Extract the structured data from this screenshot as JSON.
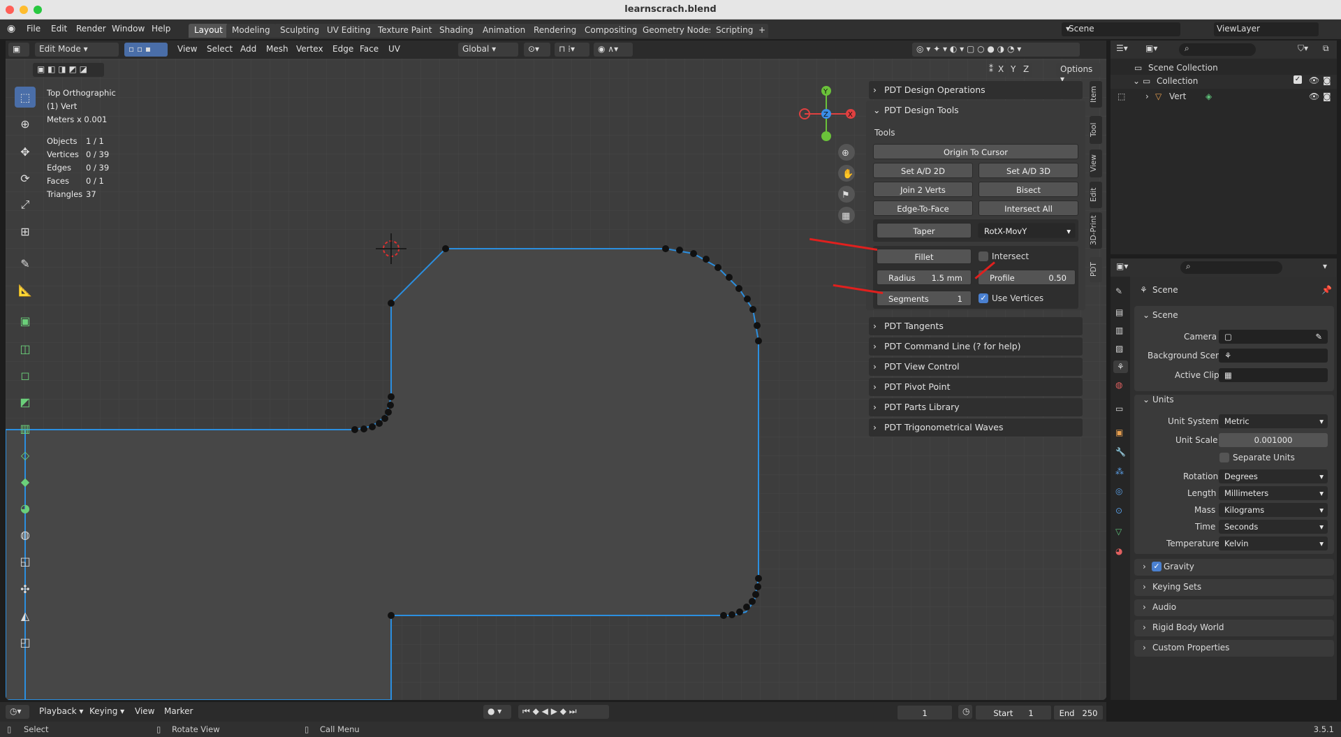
{
  "window": {
    "title": "learnscrach.blend"
  },
  "menu": [
    "File",
    "Edit",
    "Render",
    "Window",
    "Help"
  ],
  "workspaces": [
    "Layout",
    "Modeling",
    "Sculpting",
    "UV Editing",
    "Texture Paint",
    "Shading",
    "Animation",
    "Rendering",
    "Compositing",
    "Geometry Nodes",
    "Scripting"
  ],
  "scene_field": "Scene",
  "viewlayer_field": "ViewLayer",
  "viewport_header": {
    "mode": "Edit Mode",
    "menus": [
      "View",
      "Select",
      "Add",
      "Mesh",
      "Vertex",
      "Edge",
      "Face",
      "UV"
    ],
    "orientation": "Global",
    "axes": [
      "X",
      "Y",
      "Z"
    ],
    "options": "Options"
  },
  "overlay": {
    "view": "Top Orthographic",
    "object": "(1) Vert",
    "units": "Meters x 0.001",
    "stats": [
      {
        "label": "Objects",
        "value": "1 / 1"
      },
      {
        "label": "Vertices",
        "value": "0 / 39"
      },
      {
        "label": "Edges",
        "value": "0 / 39"
      },
      {
        "label": "Faces",
        "value": "0 / 1"
      },
      {
        "label": "Triangles",
        "value": "37"
      }
    ]
  },
  "pdt": {
    "design_operations": "PDT Design Operations",
    "design_tools": "PDT Design Tools",
    "tools_label": "Tools",
    "origin_to_cursor": "Origin To Cursor",
    "set_ad_2d": "Set A/D 2D",
    "set_ad_3d": "Set A/D 3D",
    "join_2_verts": "Join 2 Verts",
    "bisect": "Bisect",
    "edge_to_face": "Edge-To-Face",
    "intersect_all": "Intersect All",
    "taper": "Taper",
    "taper_mode": "RotX-MovY",
    "fillet": "Fillet",
    "intersect": "Intersect",
    "radius_label": "Radius",
    "radius_value": "1.5 mm",
    "profile_label": "Profile",
    "profile_value": "0.50",
    "segments_label": "Segments",
    "segments_value": "1",
    "use_vertices": "Use Vertices",
    "collapsed": [
      "PDT Tangents",
      "PDT Command Line (? for help)",
      "PDT View Control",
      "PDT Pivot Point",
      "PDT Parts Library",
      "PDT Trigonometrical Waves"
    ]
  },
  "side_tabs": [
    "Item",
    "Tool",
    "View",
    "Edit",
    "3D-Print",
    "PDT"
  ],
  "outliner": {
    "collection_root": "Scene Collection",
    "collection": "Collection",
    "object": "Vert"
  },
  "properties": {
    "title": "Scene",
    "scene_section": "Scene",
    "camera": "Camera",
    "background_scene": "Background Scene",
    "active_clip": "Active Clip",
    "units_section": "Units",
    "rows": [
      {
        "label": "Unit System",
        "value": "Metric"
      },
      {
        "label": "Unit Scale",
        "value": "0.001000"
      },
      {
        "label": "Rotation",
        "value": "Degrees"
      },
      {
        "label": "Length",
        "value": "Millimeters"
      },
      {
        "label": "Mass",
        "value": "Kilograms"
      },
      {
        "label": "Time",
        "value": "Seconds"
      },
      {
        "label": "Temperature",
        "value": "Kelvin"
      }
    ],
    "separate_units": "Separate Units",
    "collapsed": [
      "Gravity",
      "Keying Sets",
      "Audio",
      "Rigid Body World",
      "Custom Properties"
    ]
  },
  "timeline": {
    "playback": "Playback",
    "keying": "Keying",
    "view": "View",
    "marker": "Marker",
    "frame": "1",
    "start_label": "Start",
    "start": "1",
    "end_label": "End",
    "end": "250"
  },
  "status": {
    "select": "Select",
    "rotate": "Rotate View",
    "call_menu": "Call Menu",
    "version": "3.5.1"
  }
}
